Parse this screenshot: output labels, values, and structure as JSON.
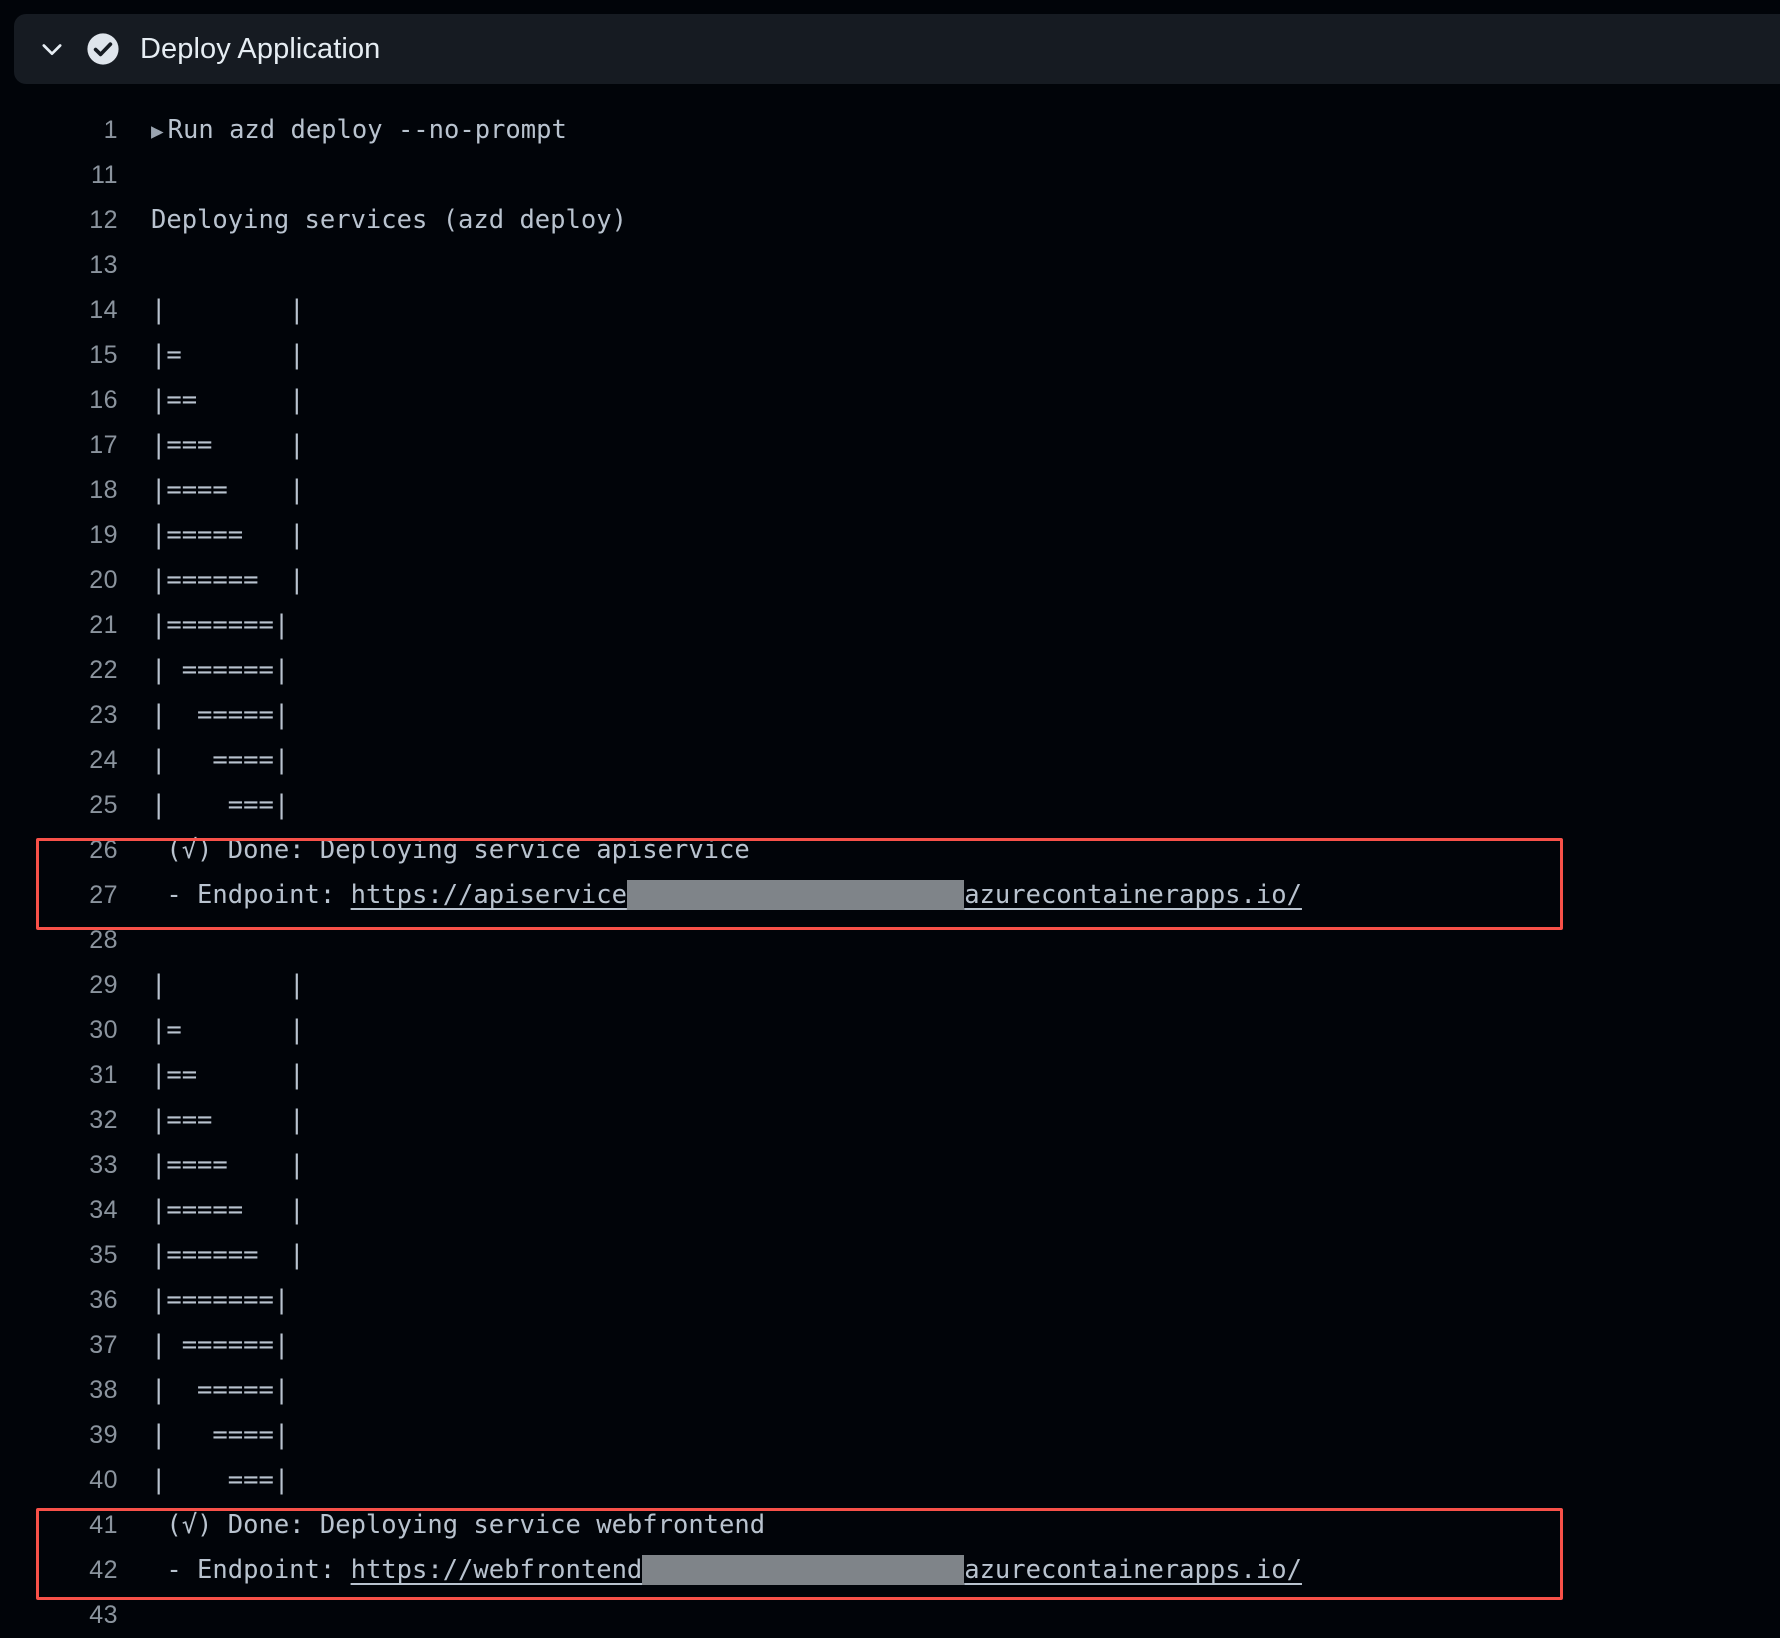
{
  "header": {
    "title": "Deploy Application",
    "collapse_icon": "chevron-down-icon",
    "status_icon": "check-circle-icon",
    "status": "success",
    "background_color": "#161b22",
    "title_color": "#e6edf3"
  },
  "colors": {
    "page_background": "#010409",
    "log_text": "#b9c3cf",
    "line_number": "#8b949e",
    "highlight_border": "#f85149",
    "redaction_block": "#7f8489"
  },
  "log": {
    "lines": [
      {
        "n": "1",
        "text": "Run azd deploy --no-prompt",
        "kind": "command"
      },
      {
        "n": "11",
        "text": "",
        "kind": "blank"
      },
      {
        "n": "12",
        "text": "Deploying services (azd deploy)",
        "kind": "text"
      },
      {
        "n": "13",
        "text": "",
        "kind": "blank"
      },
      {
        "n": "14",
        "text": "|        |",
        "kind": "progress"
      },
      {
        "n": "15",
        "text": "|=       |",
        "kind": "progress"
      },
      {
        "n": "16",
        "text": "|==      |",
        "kind": "progress"
      },
      {
        "n": "17",
        "text": "|===     |",
        "kind": "progress"
      },
      {
        "n": "18",
        "text": "|====    |",
        "kind": "progress"
      },
      {
        "n": "19",
        "text": "|=====   |",
        "kind": "progress"
      },
      {
        "n": "20",
        "text": "|======  |",
        "kind": "progress"
      },
      {
        "n": "21",
        "text": "|=======|",
        "kind": "progress"
      },
      {
        "n": "22",
        "text": "| ======|",
        "kind": "progress"
      },
      {
        "n": "23",
        "text": "|  =====|",
        "kind": "progress"
      },
      {
        "n": "24",
        "text": "|   ====|",
        "kind": "progress"
      },
      {
        "n": "25",
        "text": "|    ===|",
        "kind": "progress"
      },
      {
        "n": "26",
        "text": " (√) Done: Deploying service apiservice",
        "kind": "text",
        "highlighted": true
      },
      {
        "n": "27",
        "kind": "endpoint",
        "highlighted": true,
        "prefix": " - Endpoint: ",
        "url_visible_start": "https://apiservice",
        "url_redacted": true,
        "url_visible_end": "azurecontainerapps.io/"
      },
      {
        "n": "28",
        "text": "",
        "kind": "blank"
      },
      {
        "n": "29",
        "text": "|        |",
        "kind": "progress"
      },
      {
        "n": "30",
        "text": "|=       |",
        "kind": "progress"
      },
      {
        "n": "31",
        "text": "|==      |",
        "kind": "progress"
      },
      {
        "n": "32",
        "text": "|===     |",
        "kind": "progress"
      },
      {
        "n": "33",
        "text": "|====    |",
        "kind": "progress"
      },
      {
        "n": "34",
        "text": "|=====   |",
        "kind": "progress"
      },
      {
        "n": "35",
        "text": "|======  |",
        "kind": "progress"
      },
      {
        "n": "36",
        "text": "|=======|",
        "kind": "progress"
      },
      {
        "n": "37",
        "text": "| ======|",
        "kind": "progress"
      },
      {
        "n": "38",
        "text": "|  =====|",
        "kind": "progress"
      },
      {
        "n": "39",
        "text": "|   ====|",
        "kind": "progress"
      },
      {
        "n": "40",
        "text": "|    ===|",
        "kind": "progress"
      },
      {
        "n": "41",
        "text": " (√) Done: Deploying service webfrontend",
        "kind": "text",
        "highlighted": true
      },
      {
        "n": "42",
        "kind": "endpoint",
        "highlighted": true,
        "prefix": " - Endpoint: ",
        "url_visible_start": "https://webfrontend",
        "url_redacted": true,
        "url_visible_end": "azurecontainerapps.io/"
      },
      {
        "n": "43",
        "text": "",
        "kind": "blank"
      }
    ]
  }
}
